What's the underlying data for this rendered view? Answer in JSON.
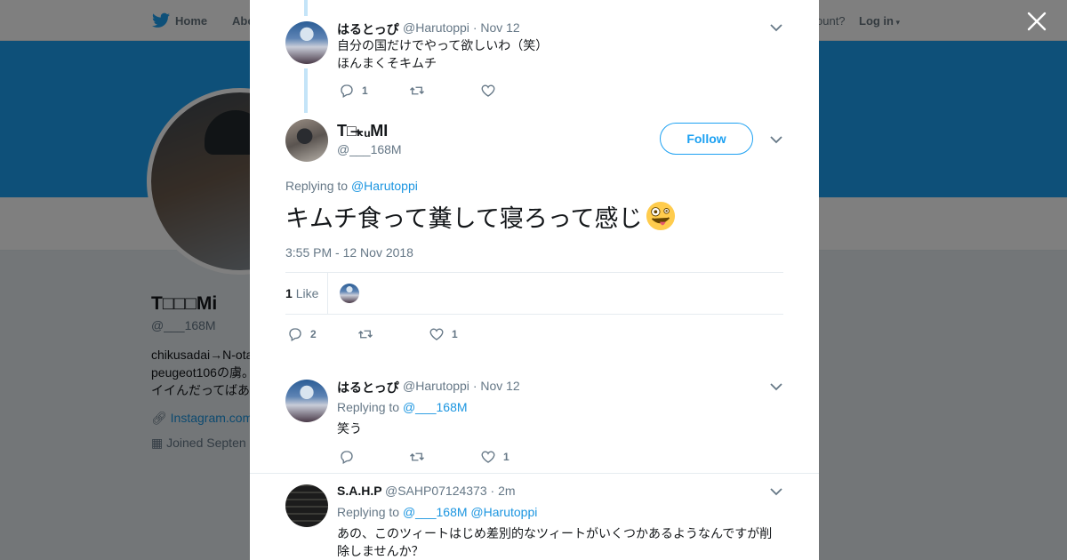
{
  "colors": {
    "accent": "#1da1f2",
    "link": "#1b95e0",
    "overlay": "rgba(0,0,0,0.5)"
  },
  "background": {
    "nav": {
      "home": "Home",
      "about": "Abo",
      "have_account": "ount?",
      "login": "Log in"
    },
    "profile": {
      "name": "T□□□Mi",
      "handle": "@___168M",
      "bio_lines": [
        "chikusadai→N-ota",
        "peugeot106の虜。",
        "イイんだってばあ"
      ],
      "link": "Instagram.com",
      "joined": "Joined Septen"
    }
  },
  "close_icon": "close-icon",
  "modal": {
    "parent_tweet": {
      "name": "はるとっぴ",
      "handle": "@Harutoppi",
      "date": "· Nov 12",
      "text_line1": "自分の国だけでやって欲しいわ（笑）",
      "text_line2": "ほんまくそキムチ",
      "reply_count": "1",
      "retweet_count": "",
      "like_count": ""
    },
    "focal_tweet": {
      "name": "T□ₖ̶ᵤMI",
      "handle": "@___168M",
      "follow_label": "Follow",
      "replying_prefix": "Replying to",
      "replying_to": "@Harutoppi",
      "text": "キムチ食って糞して寝ろって感じ",
      "emoji": "zany-face-emoji",
      "timestamp": "3:55 PM - 12 Nov 2018",
      "like_stat_count": "1",
      "like_stat_label": "Like",
      "reply_count": "2",
      "retweet_count": "",
      "like_count": "1"
    },
    "replies": [
      {
        "name": "はるとっぴ",
        "handle": "@Harutoppi",
        "date": "· Nov 12",
        "replying_prefix": "Replying to",
        "replying_to": [
          "@___168M"
        ],
        "text": "笑う",
        "reply_count": "",
        "retweet_count": "",
        "like_count": "1"
      },
      {
        "name": "S.A.H.P",
        "handle": "@SAHP07124373",
        "date": "· 2m",
        "replying_prefix": "Replying to",
        "replying_to": [
          "@___168M",
          "@Harutoppi"
        ],
        "text_line1": "あの、このツィートはじめ差別的なツィートがいくつかあるようなんですが削",
        "text_line2": "除しませんか？"
      }
    ]
  }
}
